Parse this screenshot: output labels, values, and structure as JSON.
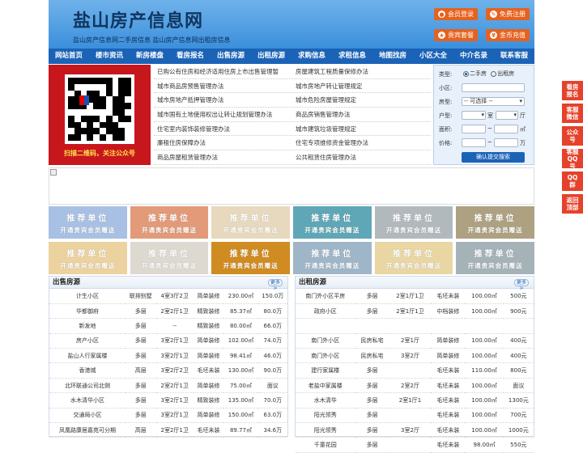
{
  "header": {
    "title": "盐山房产信息网",
    "subtitle": "盐山房产信息网二手房信息    盐山房产信息网出租房信息",
    "buttons": [
      {
        "label": "会员登录",
        "icon": "user-icon"
      },
      {
        "label": "免费注册",
        "icon": "register-icon"
      },
      {
        "label": "贵宾套餐",
        "icon": "vip-icon"
      },
      {
        "label": "金币充值",
        "icon": "coin-icon"
      }
    ]
  },
  "nav": [
    "网站首页",
    "楼市资讯",
    "新房楼盘",
    "看房报名",
    "出售房源",
    "出租房源",
    "求购信息",
    "求租信息",
    "地图找房",
    "小区大全",
    "中介名录",
    "联系客服"
  ],
  "qr": {
    "caption": "扫描二维码，关注公众号"
  },
  "links": [
    [
      "已购公有住房和经济适用住房上市出售管理暂",
      "房屋建筑工程质量保修办法"
    ],
    [
      "城市商品房预售管理办法",
      "城市房地产转让管理规定"
    ],
    [
      "城市房地产抵押管理办法",
      "城市危险房屋管理规定"
    ],
    [
      "城市国有土地使用权出让转让规划管理办法",
      "商品房销售管理办法"
    ],
    [
      "住宅室内装饰装修管理办法",
      "城市建筑垃圾管理规定"
    ],
    [
      "廉租住房保障办法",
      "住宅专项维修资金管理办法"
    ],
    [
      "商品房屋租赁管理办法",
      "公共租赁住房管理办法"
    ]
  ],
  "search": {
    "type_label": "类型:",
    "type_options": [
      "二手房",
      "出租房"
    ],
    "community_label": "小区:",
    "house_label": "房型:",
    "house_select": "-- 可选择 --",
    "layout_label": "户型:",
    "room_unit": "室",
    "hall_unit": "厅",
    "area_label": "面积:",
    "area_unit": "㎡",
    "price_label": "价格:",
    "price_unit": "万",
    "range_sep": "~",
    "submit": "确认提交搜索"
  },
  "ads": {
    "line1": "推荐单位",
    "line2": "开通贵宾会员赠送",
    "colors": [
      "#a8c0e3",
      "#e29a78",
      "#e7d9bd",
      "#5fa7b6",
      "#b1b9bd",
      "#aea182",
      "#ebd29f",
      "#ddd8d0",
      "#d08b21",
      "#9fb6c9",
      "#e9d6a2",
      "#a5b3b9"
    ]
  },
  "sale": {
    "title": "出售房源",
    "more": "更多>",
    "rows": [
      [
        "计生小区",
        "联排别墅",
        "4室3厅2卫",
        "简单装修",
        "230.00㎡",
        "150.0万"
      ],
      [
        "华都御府",
        "多层",
        "2室2厅1卫",
        "精致装修",
        "85.37㎡",
        "80.0万"
      ],
      [
        "新发地",
        "多层",
        "--",
        "精致装修",
        "80.00㎡",
        "66.0万"
      ],
      [
        "房产小区",
        "多层",
        "3室2厅1卫",
        "简单装修",
        "102.00㎡",
        "74.0万"
      ],
      [
        "盐山人行家属楼",
        "多层",
        "3室2厅1卫",
        "简单装修",
        "98.41㎡",
        "46.0万"
      ],
      [
        "香港城",
        "高层",
        "3室2厅2卫",
        "毛坯未装",
        "130.00㎡",
        "90.0万"
      ],
      [
        "北环联通公司北侧",
        "多层",
        "2室2厅1卫",
        "简单装修",
        "75.00㎡",
        "面议"
      ],
      [
        "水木清华小区",
        "多层",
        "3室2厅1卫",
        "精致装修",
        "135.00㎡",
        "70.0万"
      ],
      [
        "交通局小区",
        "多层",
        "3室2厅1卫",
        "简单装修",
        "150.00㎡",
        "63.0万"
      ],
      [
        "凤凰路康居嘉苑可分期",
        "高层",
        "2室2厅1卫",
        "毛坯未装",
        "89.77㎡",
        "34.6万"
      ]
    ]
  },
  "rent": {
    "title": "出租房源",
    "more": "更多>",
    "rows": [
      [
        "南门外小区平房",
        "多层",
        "2室1厅1卫",
        "毛坯未装",
        "100.00㎡",
        "500元"
      ],
      [
        "政府小区",
        "多层",
        "2室1厅1卫",
        "中档装修",
        "100.00㎡",
        "900元"
      ],
      [
        "",
        "",
        "",
        "",
        "",
        ""
      ],
      [
        "南门外小区",
        "民房私宅",
        "2室1厅",
        "简单装修",
        "100.00㎡",
        "400元"
      ],
      [
        "南门外小区",
        "民房私宅",
        "3室2厅",
        "简单装修",
        "100.00㎡",
        "400元"
      ],
      [
        "建行家属楼",
        "多层",
        "",
        "毛坯未装",
        "110.00㎡",
        "800元"
      ],
      [
        "老盐中家属楼",
        "多层",
        "2室2厅",
        "毛坯未装",
        "100.00㎡",
        "面议"
      ],
      [
        "水木清华",
        "多层",
        "2室1厅1",
        "毛坯未装",
        "100.00㎡",
        "1300元"
      ],
      [
        "阳光领秀",
        "多层",
        "",
        "毛坯未装",
        "100.00㎡",
        "700元"
      ],
      [
        "阳光领秀",
        "多层",
        "3室2厅",
        "毛坯未装",
        "100.00㎡",
        "1000元"
      ],
      [
        "千童花园",
        "多层",
        "",
        "毛坯未装",
        "98.00㎡",
        "550元"
      ]
    ]
  },
  "side": [
    "看房报名",
    "客服微信",
    "公众号",
    "客服QQ号",
    "QQ群",
    "返回顶部"
  ]
}
